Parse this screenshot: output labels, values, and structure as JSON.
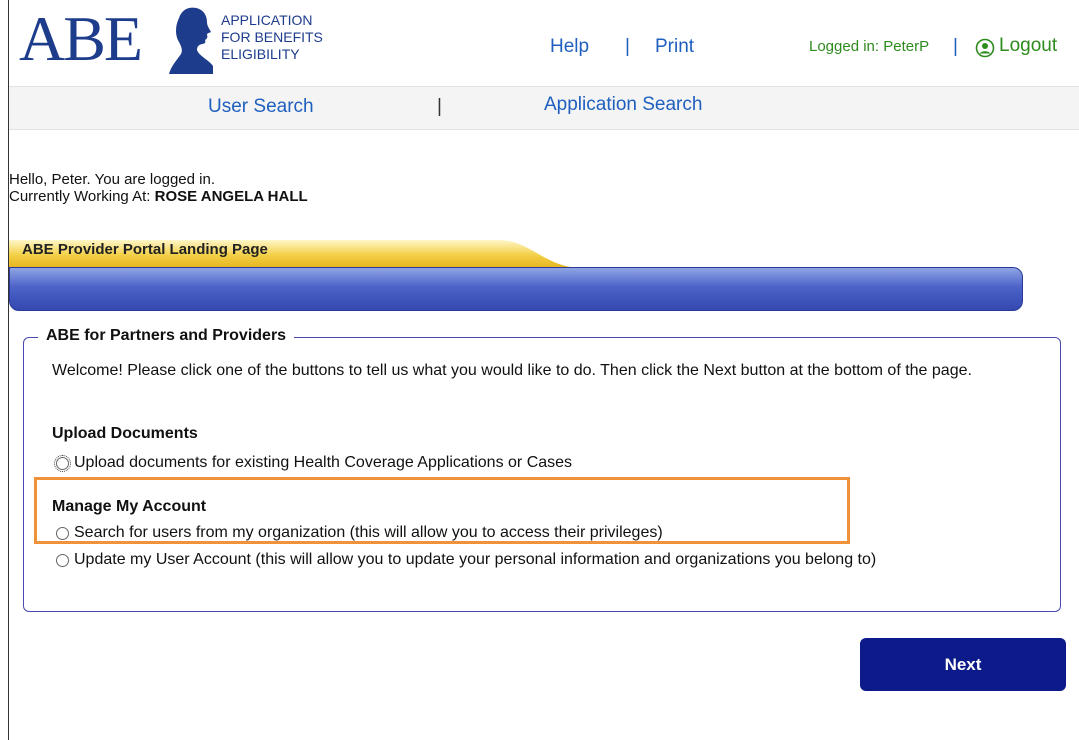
{
  "header": {
    "logo_abbr": "ABE",
    "logo_lines": [
      "APPLICATION",
      "FOR BENEFITS",
      "ELIGIBILITY"
    ],
    "help_label": "Help",
    "separator": "|",
    "print_label": "Print",
    "logged_in_text": "Logged in: PeterP",
    "logout_label": "Logout"
  },
  "subnav": {
    "user_search_label": "User Search",
    "separator": "|",
    "application_search_label": "Application Search"
  },
  "greeting": {
    "hello_text": "Hello, Peter. You are logged in.",
    "working_at_label": "Currently Working At: ",
    "working_at_value": "ROSE ANGELA HALL"
  },
  "page_tab": {
    "label": "ABE Provider Portal Landing Page"
  },
  "fieldset": {
    "legend": "ABE for Partners and Providers",
    "welcome": "Welcome! Please click one of the buttons to tell us what you would like to do. Then click the Next button at the bottom of the page.",
    "upload_section": {
      "title": "Upload Documents",
      "option": "Upload documents for existing Health Coverage Applications or Cases"
    },
    "manage_section": {
      "title": "Manage My Account",
      "option_search": "Search for users from my organization (this will allow you to access their privileges)",
      "option_update": "Update my User Account (this will allow you to update your personal information and organizations you belong to)"
    }
  },
  "next_button_label": "Next",
  "colors": {
    "brand_blue": "#1d3c8c",
    "link_blue": "#1f5fbf",
    "logged_in_green": "#2e8b1e",
    "tab_gold": "#f0c430",
    "bar_blue": "#3448b0",
    "highlight_orange": "#f0923a",
    "button_navy": "#0c1a8a"
  },
  "icons": {
    "logo_silhouette": "profile-silhouette-icon",
    "logout": "user-circle-icon"
  }
}
